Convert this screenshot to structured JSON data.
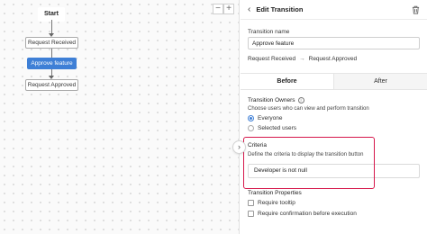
{
  "canvas": {
    "zoom_out_label": "−",
    "zoom_in_label": "+",
    "start_label": "Start",
    "nodes": {
      "from_state": "Request Received",
      "transition": "Approve feature",
      "to_state": "Request Approved"
    },
    "expand_icon": "›"
  },
  "panel": {
    "back_icon": "‹",
    "title": "Edit Transition",
    "name_label": "Transition name",
    "name_value": "Approve feature",
    "route_from": "Request Received",
    "route_arrow": "→",
    "route_to": "Request Approved",
    "tabs": [
      {
        "label": "Before",
        "active": true
      },
      {
        "label": "After",
        "active": false
      }
    ],
    "owners": {
      "title": "Transition Owners",
      "info_icon": "i",
      "help": "Choose users who can view and perform transition",
      "options": [
        {
          "label": "Everyone",
          "checked": true
        },
        {
          "label": "Selected users",
          "checked": false
        }
      ]
    },
    "criteria": {
      "title": "Criteria",
      "help": "Define the criteria to display the transition button",
      "value": "Developer is not null"
    },
    "properties": {
      "title": "Transition Properties",
      "options": [
        {
          "label": "Require tooltip",
          "checked": false
        },
        {
          "label": "Require confirmation before execution",
          "checked": false
        }
      ]
    }
  },
  "colors": {
    "accent": "#3e7fd6",
    "highlight_border": "#d6174b"
  }
}
